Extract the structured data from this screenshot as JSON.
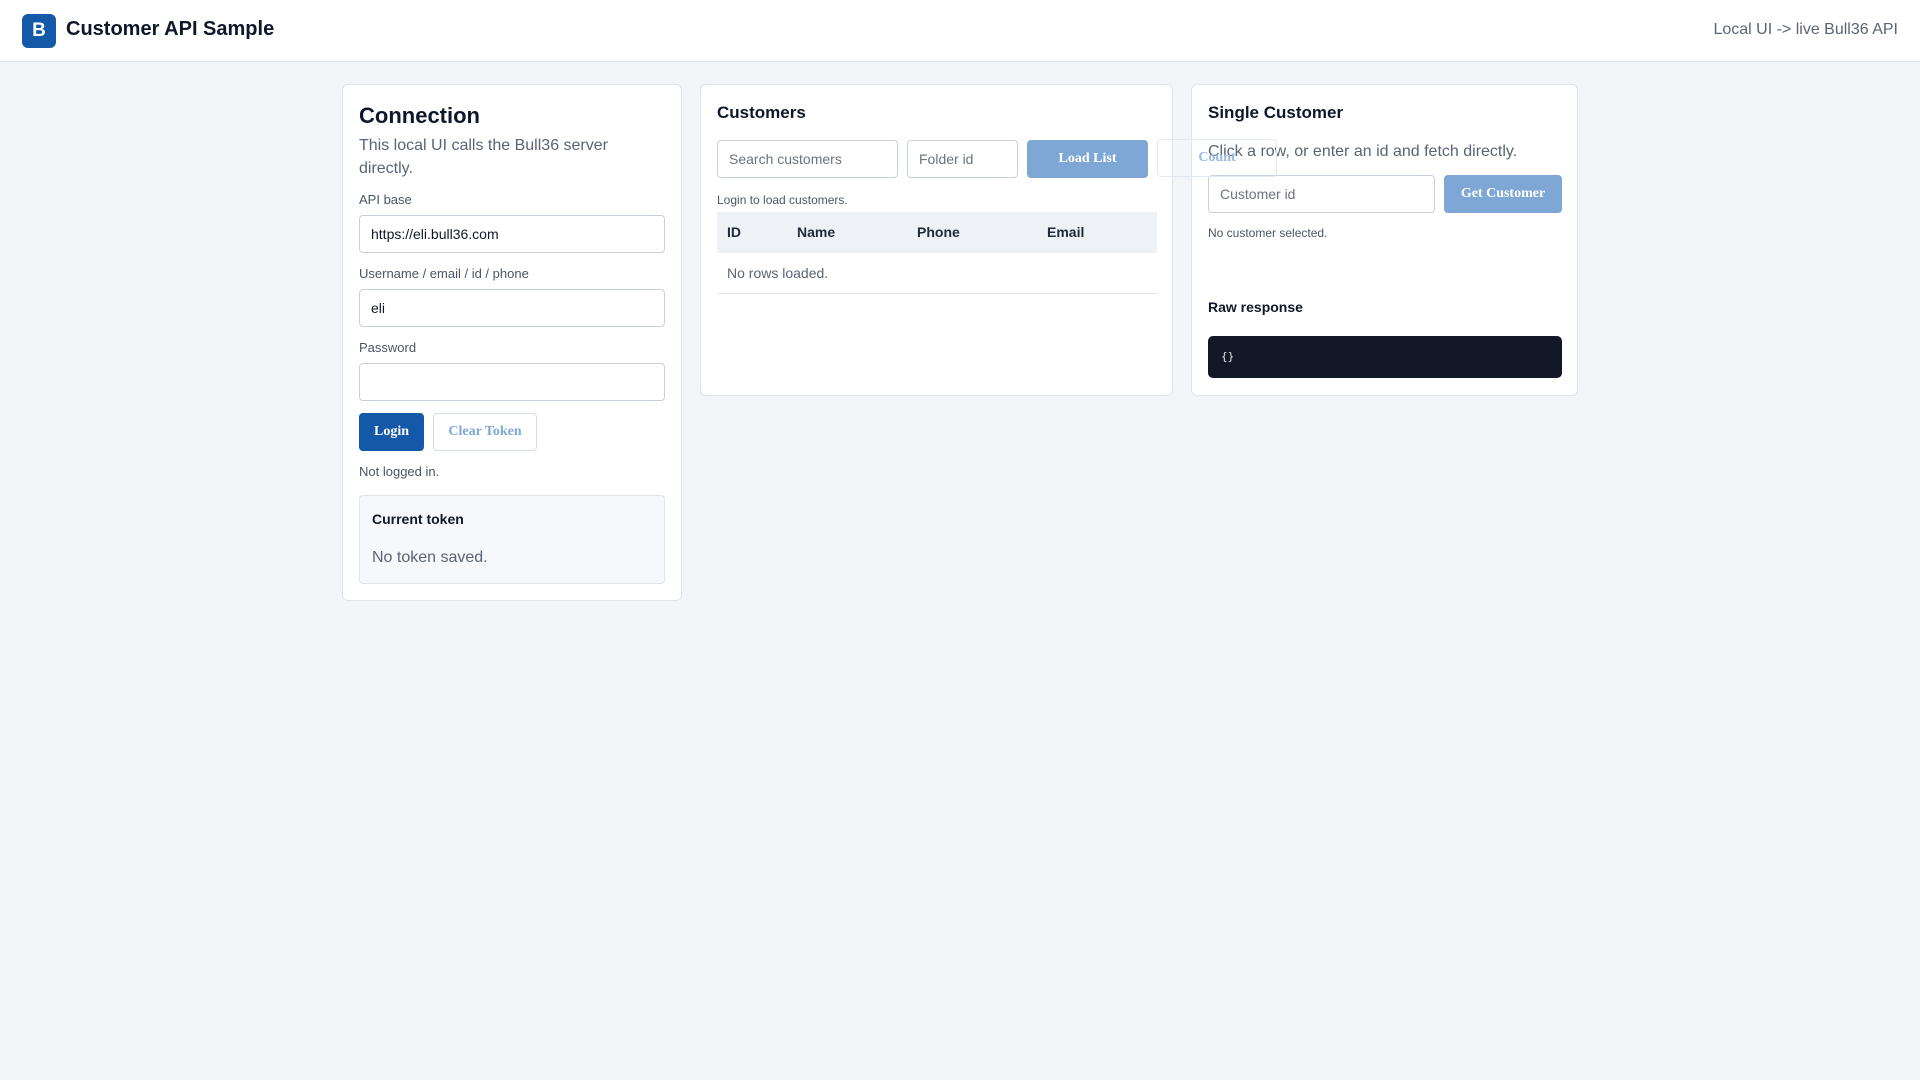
{
  "header": {
    "logo_letter": "B",
    "title": "Customer API Sample",
    "right_text": "Local UI -> live Bull36 API"
  },
  "connection": {
    "title": "Connection",
    "subtitle": "This local UI calls the Bull36 server directly.",
    "api_base_label": "API base",
    "api_base_value": "https://eli.bull36.com",
    "username_label": "Username / email / id / phone",
    "username_value": "eli",
    "password_label": "Password",
    "password_value": "",
    "login_label": "Login",
    "clear_token_label": "Clear Token",
    "status": "Not logged in.",
    "token_title": "Current token",
    "token_value": "No token saved."
  },
  "customers": {
    "title": "Customers",
    "search_placeholder": "Search customers",
    "folder_placeholder": "Folder id",
    "load_list_label": "Load List",
    "count_label": "Count",
    "status": "Login to load customers.",
    "columns": [
      "ID",
      "Name",
      "Phone",
      "Email"
    ],
    "empty_text": "No rows loaded."
  },
  "single": {
    "title": "Single Customer",
    "hint": "Click a row, or enter an id and fetch directly.",
    "id_placeholder": "Customer id",
    "get_label": "Get Customer",
    "status": "No customer selected.",
    "raw_title": "Raw response",
    "raw_value": "{}"
  }
}
